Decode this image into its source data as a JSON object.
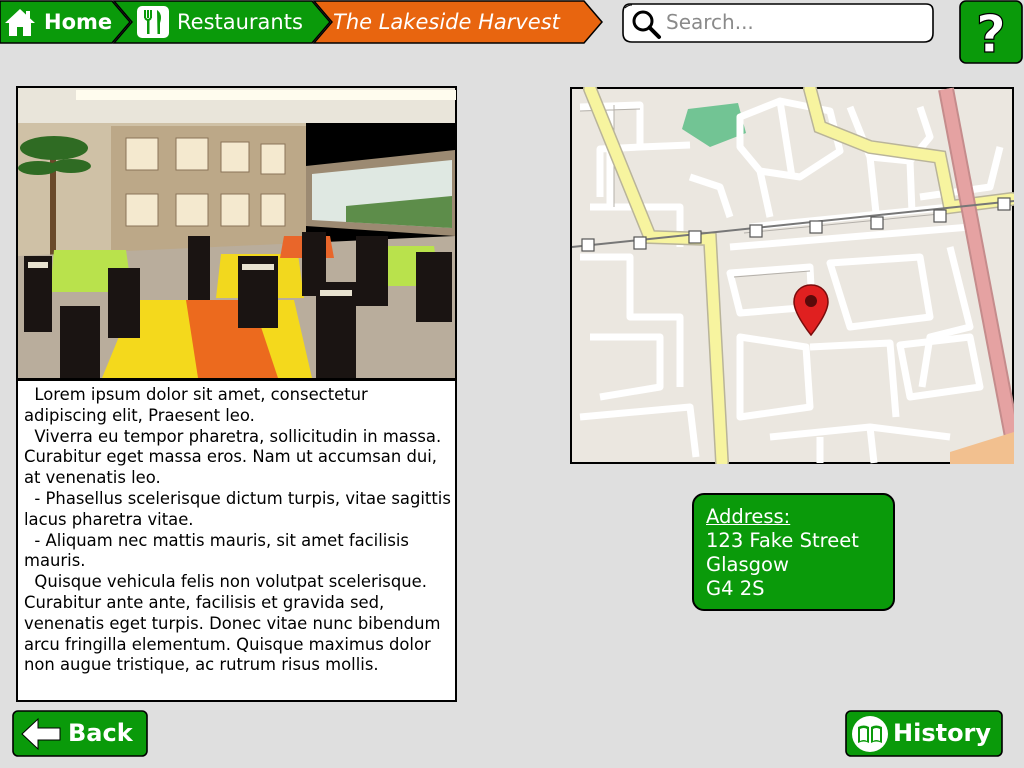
{
  "breadcrumb": {
    "home_label": "Home",
    "restaurants_label": "Restaurants",
    "current_label": "The Lakeside Harvest"
  },
  "search": {
    "placeholder": "Search..."
  },
  "help": {
    "icon": "question-mark-icon",
    "label": "?"
  },
  "restaurant": {
    "description": [
      "  Lorem ipsum dolor sit amet, consectetur adipiscing elit, Praesent leo.",
      "  Viverra eu tempor pharetra, sollicitudin in massa. Curabitur eget massa eros. Nam ut accumsan dui, at venenatis leo.",
      "  - Phasellus scelerisque dictum turpis, vitae sagittis lacus pharetra vitae.",
      "  - Aliquam nec mattis mauris, sit amet facilisis mauris.",
      "  Quisque vehicula felis non volutpat scelerisque. Curabitur ante ante, facilisis et gravida sed, venenatis eget turpis. Donec vitae nunc bibendum arcu fringilla elementum. Quisque maximus dolor non augue tristique, ac rutrum risus mollis."
    ],
    "address": {
      "title": "Address:",
      "line1": "123 Fake Street",
      "line2": "Glasgow",
      "line3": "G4 2S"
    }
  },
  "buttons": {
    "back_label": "Back",
    "history_label": "History"
  },
  "colors": {
    "green": "#0a9a0a",
    "orange": "#e8650f",
    "background": "#dfdfdf",
    "pin": "#e02020"
  },
  "icons": [
    "home-icon",
    "fork-knife-icon",
    "search-icon",
    "question-mark-icon",
    "back-arrow-icon",
    "book-icon",
    "map-pin-icon"
  ]
}
